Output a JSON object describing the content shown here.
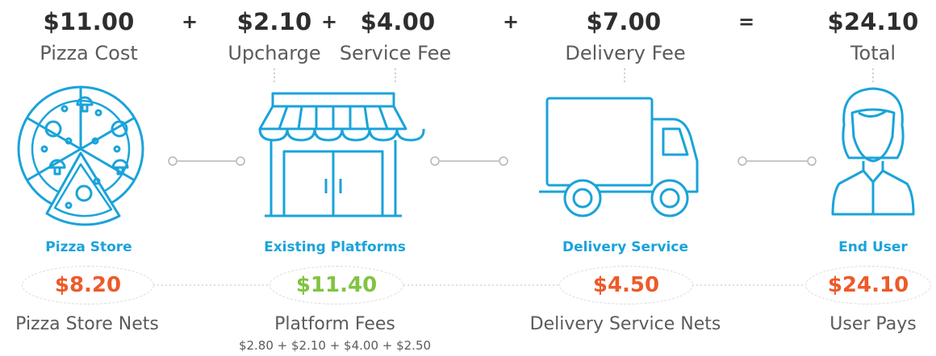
{
  "equation": {
    "pizza_cost": {
      "amount": "$11.00",
      "label": "Pizza Cost"
    },
    "upcharge": {
      "amount": "$2.10",
      "label": "Upcharge"
    },
    "service_fee": {
      "amount": "$4.00",
      "label": "Service Fee"
    },
    "delivery_fee": {
      "amount": "$7.00",
      "label": "Delivery Fee"
    },
    "total": {
      "amount": "$24.10",
      "label": "Total"
    },
    "ops": [
      "+",
      "+",
      "+",
      "="
    ]
  },
  "entities": [
    {
      "name": "Pizza Store",
      "icon": "pizza-icon",
      "net": "$8.20",
      "net_color": "#ee5a29",
      "net_label": "Pizza Store Nets"
    },
    {
      "name": "Existing Platforms",
      "icon": "storefront-icon",
      "net": "$11.40",
      "net_color": "#82c341",
      "net_label": "Platform Fees",
      "formula": "$2.80 + $2.10 + $4.00 + $2.50"
    },
    {
      "name": "Delivery Service",
      "icon": "delivery-truck-icon",
      "net": "$4.50",
      "net_color": "#ee5a29",
      "net_label": "Delivery Service Nets"
    },
    {
      "name": "End User",
      "icon": "user-icon",
      "net": "$24.10",
      "net_color": "#ee5a29",
      "net_label": "User Pays"
    }
  ],
  "colors": {
    "accent": "#1aa3da",
    "orange": "#ee5a29",
    "green": "#82c341",
    "text": "#2e2e2e",
    "muted": "#5b5b5b"
  }
}
